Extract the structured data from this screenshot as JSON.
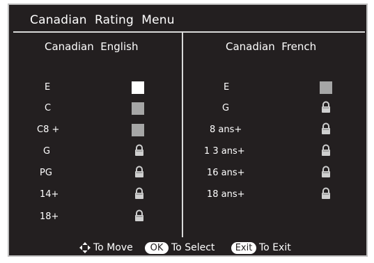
{
  "title": "Canadian  Rating  Menu",
  "english": {
    "header": "Canadian  English",
    "rows": [
      {
        "label": "E",
        "status": "white"
      },
      {
        "label": "C",
        "status": "gray"
      },
      {
        "label": "C8 +",
        "status": "gray"
      },
      {
        "label": "G",
        "status": "lock"
      },
      {
        "label": "PG",
        "status": "lock"
      },
      {
        "label": "14+",
        "status": "lock"
      },
      {
        "label": "18+",
        "status": "lock"
      }
    ]
  },
  "french": {
    "header": "Canadian  French",
    "rows": [
      {
        "label": "E",
        "status": "gray"
      },
      {
        "label": "G",
        "status": "lock"
      },
      {
        "label": "8 ans+",
        "status": "lock"
      },
      {
        "label": "1 3 ans+",
        "status": "lock"
      },
      {
        "label": "16 ans+",
        "status": "lock"
      },
      {
        "label": "18 ans+",
        "status": "lock"
      }
    ]
  },
  "footer": {
    "move_icon": "four-way-arrows-icon",
    "move_text": "To Move",
    "ok_label": "OK",
    "select_text": "To Select",
    "exit_label": "Exit",
    "exit_text": "To Exit"
  },
  "colors": {
    "background": "#231f20",
    "text": "#ffffff",
    "checked_box": "#ffffff",
    "unchecked_box": "#a6a6a6",
    "lock": "#cfcfcf"
  }
}
